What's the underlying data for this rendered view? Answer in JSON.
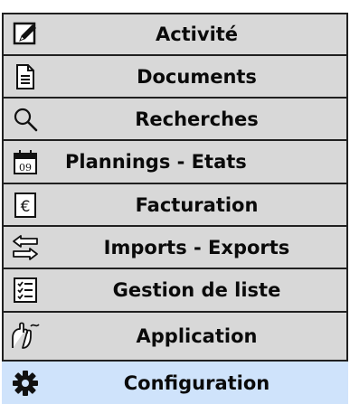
{
  "menu": {
    "items": [
      {
        "label": "Activité",
        "icon": "pencil-icon"
      },
      {
        "label": "Documents",
        "icon": "document-icon"
      },
      {
        "label": "Recherches",
        "icon": "magnifier-icon"
      },
      {
        "label": "Plannings - Etats",
        "icon": "calendar-icon",
        "icon_text": "09"
      },
      {
        "label": "Facturation",
        "icon": "euro-icon",
        "icon_text": "€"
      },
      {
        "label": "Imports - Exports",
        "icon": "transfer-arrows-icon"
      },
      {
        "label": "Gestion de liste",
        "icon": "checklist-icon"
      },
      {
        "label": "Application",
        "icon": "cursor-hand-icon"
      },
      {
        "label": "Configuration",
        "icon": "gear-icon",
        "selected": true
      }
    ]
  },
  "colors": {
    "item_bg": "#d8d8d8",
    "selected_bg": "#cfe3fb",
    "border": "#202020",
    "text": "#0a0a0a"
  }
}
